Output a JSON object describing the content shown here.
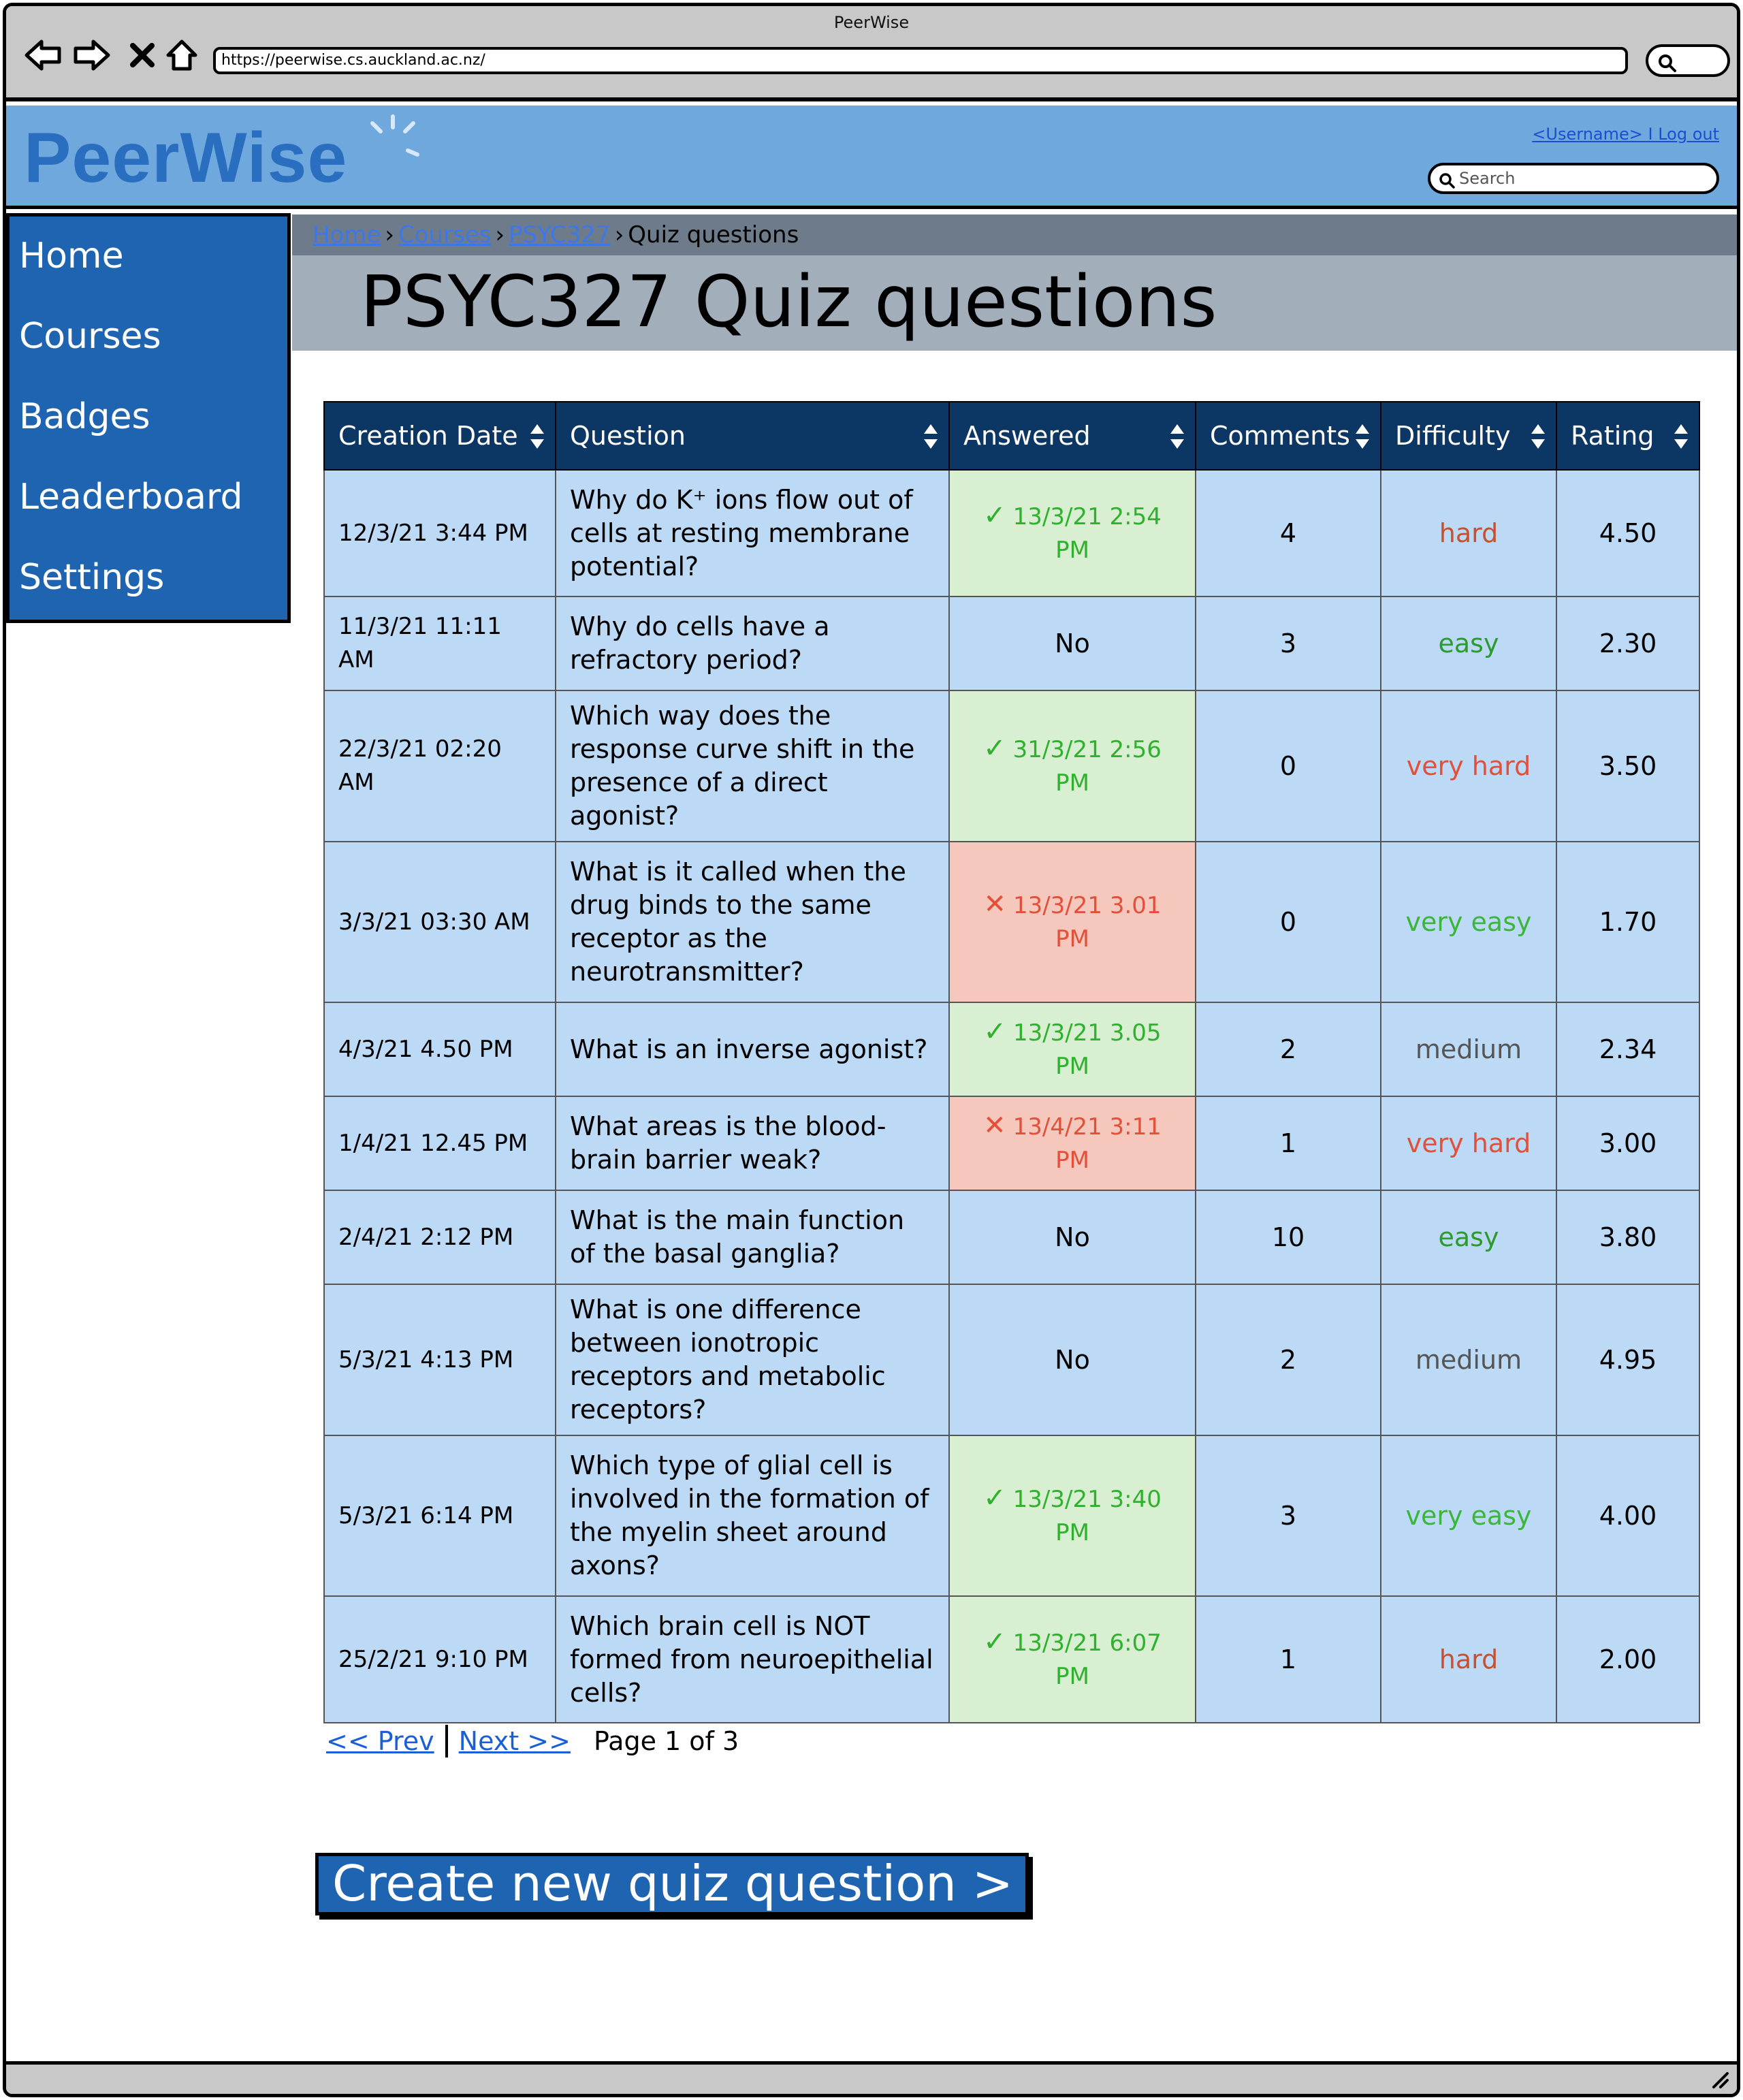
{
  "browser": {
    "window_title": "PeerWise",
    "url": "https://peerwise.cs.auckland.ac.nz/"
  },
  "header": {
    "logo": "PeerWise",
    "user_link": "<Username> I Log out",
    "search_placeholder": "Search"
  },
  "sidebar": {
    "items": [
      {
        "label": "Home"
      },
      {
        "label": "Courses"
      },
      {
        "label": "Badges"
      },
      {
        "label": "Leaderboard"
      },
      {
        "label": "Settings"
      }
    ]
  },
  "breadcrumb": {
    "items": [
      {
        "label": "Home"
      },
      {
        "label": "Courses"
      },
      {
        "label": "PSYC327"
      }
    ],
    "current": "Quiz questions"
  },
  "page_title": "PSYC327 Quiz questions",
  "table": {
    "columns": [
      {
        "label": "Creation Date"
      },
      {
        "label": "Question"
      },
      {
        "label": "Answered"
      },
      {
        "label": "Comments"
      },
      {
        "label": "Difficulty"
      },
      {
        "label": "Rating"
      }
    ],
    "rows": [
      {
        "date": "12/3/21 3:44 PM",
        "question": "Why do K⁺ ions flow out of cells at resting membrane potential?",
        "answered": "13/3/21 2:54 PM",
        "status": "correct",
        "comments": "4",
        "difficulty": "hard",
        "difficulty_color": "#c8502e",
        "rating": "4.50"
      },
      {
        "date": "11/3/21 11:11 AM",
        "question": "Why do cells have a refractory period?",
        "answered": "No",
        "status": "none",
        "comments": "3",
        "difficulty": "easy",
        "difficulty_color": "#2d9a2d",
        "rating": "2.30"
      },
      {
        "date": "22/3/21 02:20 AM",
        "question": "Which way does the response curve shift in the presence of a direct agonist?",
        "answered": "31/3/21 2:56 PM",
        "status": "correct",
        "comments": "0",
        "difficulty": "very hard",
        "difficulty_color": "#e2503a",
        "rating": "3.50"
      },
      {
        "date": "3/3/21 03:30 AM",
        "question": "What is it called when the drug binds to the same receptor as the neurotransmitter?",
        "answered": "13/3/21 3.01 PM",
        "status": "wrong",
        "comments": "0",
        "difficulty": "very easy",
        "difficulty_color": "#3cb53c",
        "rating": "1.70"
      },
      {
        "date": "4/3/21 4.50 PM",
        "question": "What is an inverse agonist?",
        "answered": "13/3/21 3.05 PM",
        "status": "correct",
        "comments": "2",
        "difficulty": "medium",
        "difficulty_color": "#555555",
        "rating": "2.34"
      },
      {
        "date": "1/4/21  12.45 PM",
        "question": "What areas is the blood-brain barrier weak?",
        "answered": "13/4/21 3:11 PM",
        "status": "wrong",
        "comments": "1",
        "difficulty": "very hard",
        "difficulty_color": "#e2503a",
        "rating": "3.00"
      },
      {
        "date": "2/4/21  2:12 PM",
        "question": "What is the main function of the basal ganglia?",
        "answered": "No",
        "status": "none",
        "comments": "10",
        "difficulty": "easy",
        "difficulty_color": "#2d9a2d",
        "rating": "3.80"
      },
      {
        "date": "5/3/21  4:13 PM",
        "question": "What is one difference between ionotropic receptors and metabolic receptors?",
        "answered": "No",
        "status": "none",
        "comments": "2",
        "difficulty": "medium",
        "difficulty_color": "#555555",
        "rating": "4.95"
      },
      {
        "date": "5/3/21  6:14 PM",
        "question": "Which type of glial cell is involved in the formation of the myelin sheet around axons?",
        "answered": "13/3/21 3:40 PM",
        "status": "correct",
        "comments": "3",
        "difficulty": "very easy",
        "difficulty_color": "#3cb53c",
        "rating": "4.00"
      },
      {
        "date": "25/2/21 9:10 PM",
        "question": "Which brain cell is NOT formed from neuroepithelial cells?",
        "answered": "13/3/21 6:07 PM",
        "status": "correct",
        "comments": "1",
        "difficulty": "hard",
        "difficulty_color": "#c8502e",
        "rating": "2.00"
      }
    ]
  },
  "pagination": {
    "prev": "<< Prev",
    "next": "Next >>",
    "page_info": "Page 1 of 3"
  },
  "create_button": "Create new quiz question >",
  "colors": {
    "header_bg": "#6fa8dc",
    "sidebar_bg": "#1f64b0",
    "table_header_bg": "#0c3764",
    "row_bg": "#bcd9f5",
    "correct_bg": "#d8f0d1",
    "wrong_bg": "#f6c8bd"
  },
  "icons": {
    "correct": "check-icon",
    "wrong": "cross-icon",
    "sort": "sort-icon"
  }
}
